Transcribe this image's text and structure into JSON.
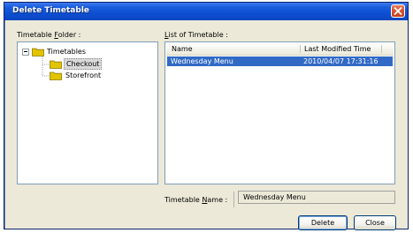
{
  "window": {
    "title": "Delete Timetable"
  },
  "folder_panel": {
    "label_prefix": "Timetable ",
    "label_mnemonic": "F",
    "label_suffix": "older :",
    "tree": {
      "root": "Timetables",
      "children": [
        "Checkout",
        "Storefront"
      ],
      "selected": "Checkout"
    }
  },
  "list_panel": {
    "label_mnemonic": "L",
    "label_suffix": "ist of Timetable :",
    "columns": [
      "Name",
      "Last Modified Time"
    ],
    "rows": [
      {
        "name": "Wednesday Menu",
        "modified": "2010/04/07 17:31:16",
        "selected": true
      }
    ]
  },
  "name_field": {
    "label_prefix": "Timetable ",
    "label_mnemonic": "N",
    "label_suffix": "ame :",
    "value": "Wednesday Menu"
  },
  "buttons": {
    "delete": "Delete",
    "close": "Close"
  },
  "colors": {
    "titlebar": "#0d4fd2",
    "selection": "#316ac5",
    "dialog_bg": "#ece9d8",
    "close_button": "#d8522c"
  }
}
